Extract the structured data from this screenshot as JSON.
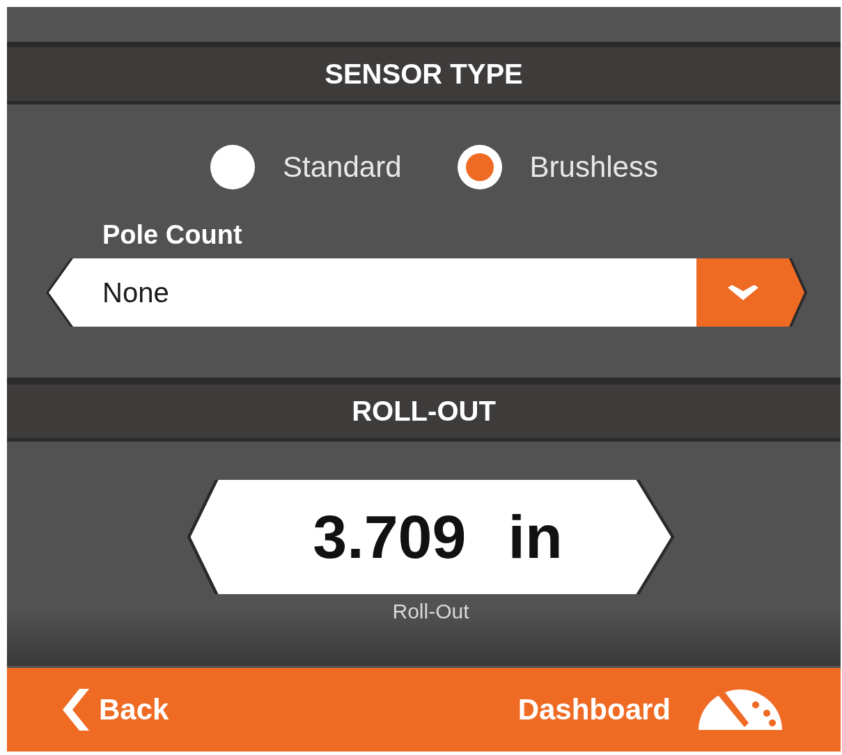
{
  "sections": [
    {
      "kind": "radio",
      "title": "SENSOR TYPE",
      "options": [
        {
          "label": "Standard",
          "selected": false
        },
        {
          "label": "Brushless",
          "selected": true
        }
      ],
      "dropdown": {
        "label": "Pole Count",
        "value": "None"
      }
    },
    {
      "kind": "value",
      "title": "ROLL-OUT",
      "value": "3.709",
      "unit": "in",
      "caption": "Roll-Out"
    }
  ],
  "footer": {
    "back": "Back",
    "dashboard": "Dashboard"
  }
}
